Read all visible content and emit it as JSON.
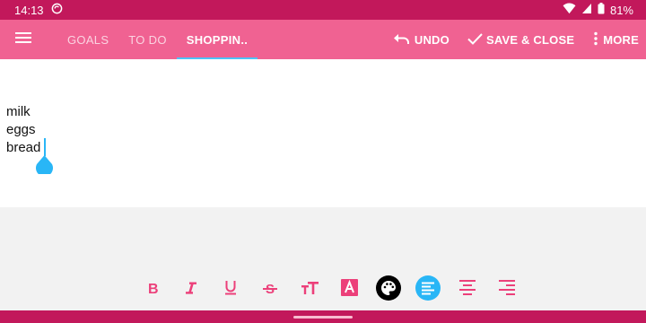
{
  "status_bar": {
    "time": "14:13",
    "battery": "81%",
    "icons": [
      "sync-icon",
      "wifi-icon",
      "signal-icon",
      "battery-icon"
    ]
  },
  "app_bar": {
    "tabs": [
      {
        "label": "GOALS",
        "active": false
      },
      {
        "label": "TO DO",
        "active": false
      },
      {
        "label": "SHOPPIN..",
        "active": true
      }
    ],
    "undo_label": "UNDO",
    "save_close_label": "SAVE & CLOSE",
    "more_label": "MORE"
  },
  "editor": {
    "lines": [
      "milk",
      "eggs",
      "bread"
    ]
  },
  "toolbar": {
    "tools": [
      "bold-icon",
      "italic-icon",
      "underline-icon",
      "strikethrough-icon",
      "text-size-icon",
      "text-color-icon",
      "palette-icon",
      "align-left-icon",
      "align-center-icon",
      "align-right-icon"
    ],
    "active_tool": "align-left-icon"
  },
  "colors": {
    "status_bar": "#c2185b",
    "app_bar": "#f06292",
    "accent": "#ec407a",
    "selection": "#29b6f6",
    "text": "#111111"
  }
}
